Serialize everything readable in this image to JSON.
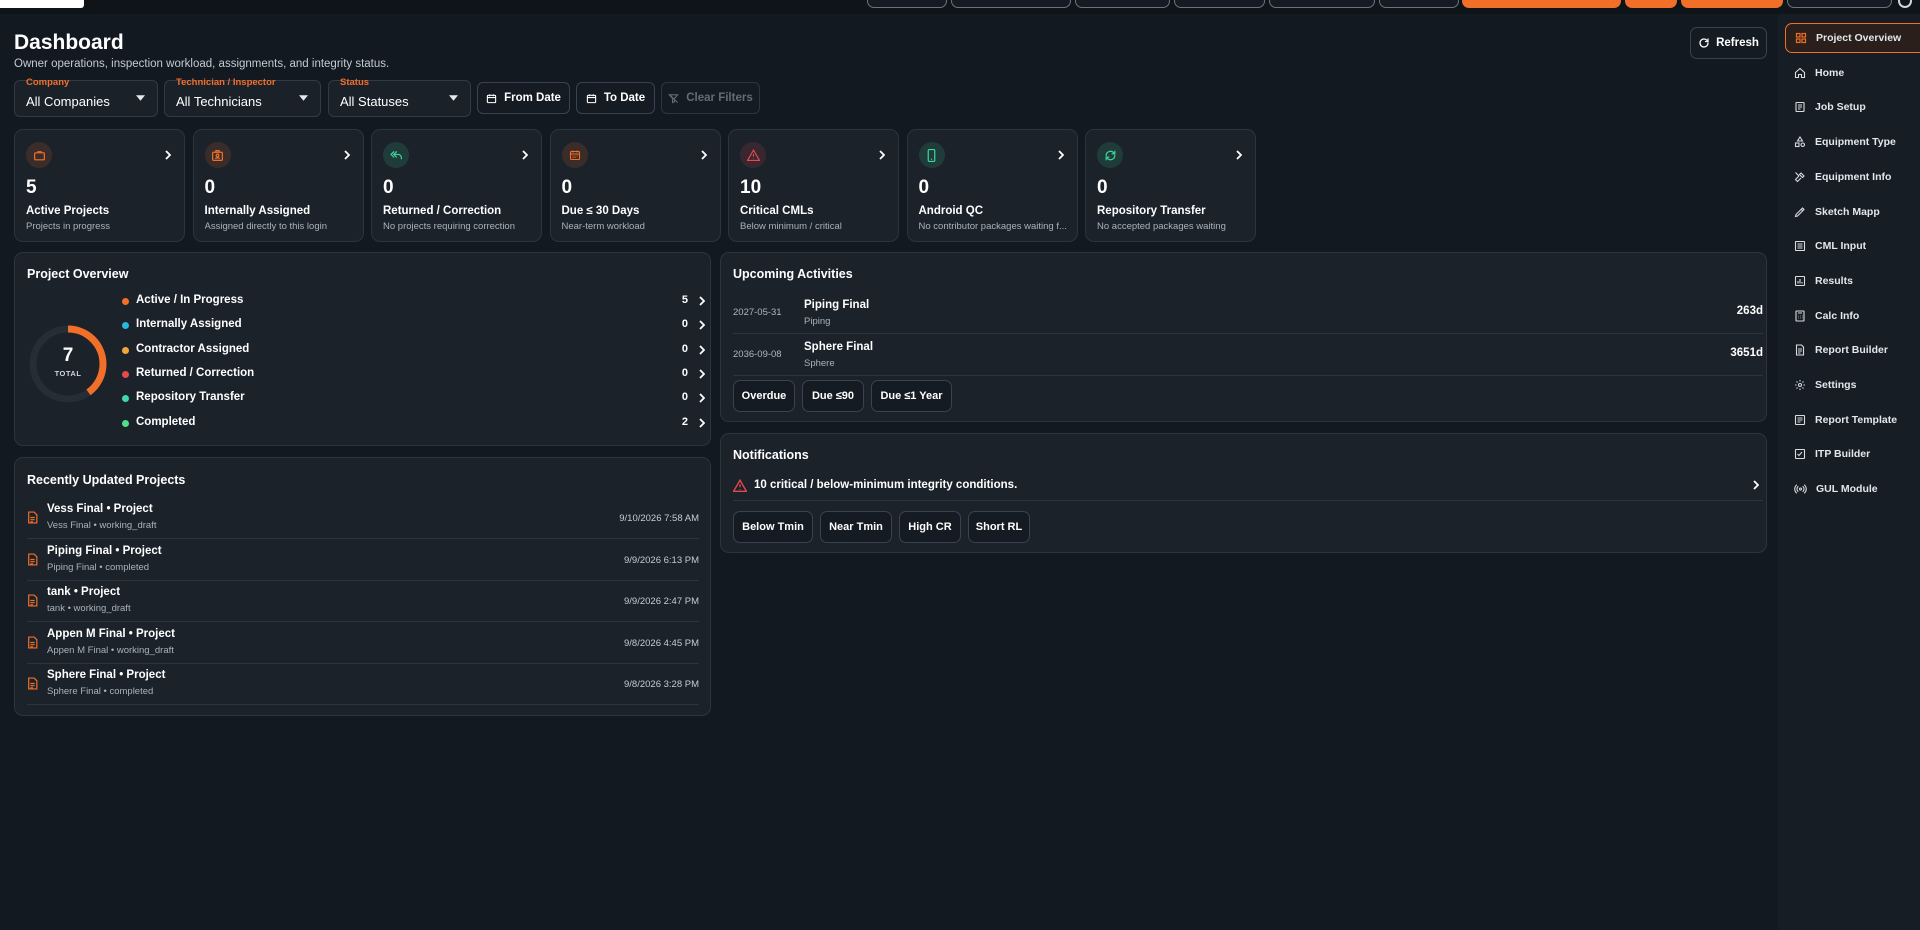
{
  "page": {
    "title": "Dashboard",
    "subtitle": "Owner operations, inspection workload, assignments, and integrity status.",
    "refresh_label": "Refresh"
  },
  "filters": {
    "company": {
      "label": "Company",
      "value": "All Companies"
    },
    "technician": {
      "label": "Technician / Inspector",
      "value": "All Technicians"
    },
    "status": {
      "label": "Status",
      "value": "All Statuses"
    },
    "from_date": "From Date",
    "to_date": "To Date",
    "clear": "Clear Filters"
  },
  "stats": [
    {
      "value": "5",
      "label": "Active Projects",
      "sub": "Projects in progress",
      "icon": "briefcase-icon",
      "color": "#f26f2a"
    },
    {
      "value": "0",
      "label": "Internally Assigned",
      "sub": "Assigned directly to this login",
      "icon": "user-badge-icon",
      "color": "#f26f2a"
    },
    {
      "value": "0",
      "label": "Returned / Correction",
      "sub": "No projects requiring correction",
      "icon": "reply-all-icon",
      "color": "#3fd69b"
    },
    {
      "value": "0",
      "label": "Due ≤ 30 Days",
      "sub": "Near-term workload",
      "icon": "calendar-icon",
      "color": "#f26f2a"
    },
    {
      "value": "10",
      "label": "Critical CMLs",
      "sub": "Below minimum / critical",
      "icon": "warning-icon",
      "color": "#e5484d"
    },
    {
      "value": "0",
      "label": "Android QC",
      "sub": "No contributor packages waiting f...",
      "icon": "mobile-icon",
      "color": "#3fd69b"
    },
    {
      "value": "0",
      "label": "Repository Transfer",
      "sub": "No accepted packages waiting",
      "icon": "sync-icon",
      "color": "#3fd69b"
    }
  ],
  "overview": {
    "title": "Project Overview",
    "total": "7",
    "total_label": "TOTAL",
    "items": [
      {
        "label": "Active / In Progress",
        "count": "5",
        "color": "#f26f2a"
      },
      {
        "label": "Internally Assigned",
        "count": "0",
        "color": "#2bb5e0"
      },
      {
        "label": "Contractor Assigned",
        "count": "0",
        "color": "#f2a53a"
      },
      {
        "label": "Returned / Correction",
        "count": "0",
        "color": "#e5484d"
      },
      {
        "label": "Repository Transfer",
        "count": "0",
        "color": "#3fd6b0"
      },
      {
        "label": "Completed",
        "count": "2",
        "color": "#4fe08a"
      }
    ]
  },
  "recent": {
    "title": "Recently Updated Projects",
    "items": [
      {
        "title": "Vess Final • Project",
        "sub": "Vess Final • working_draft",
        "time": "9/10/2026 7:58 AM"
      },
      {
        "title": "Piping Final • Project",
        "sub": "Piping Final • completed",
        "time": "9/9/2026 6:13 PM"
      },
      {
        "title": "tank • Project",
        "sub": "tank • working_draft",
        "time": "9/9/2026 2:47 PM"
      },
      {
        "title": "Appen M Final • Project",
        "sub": "Appen M Final • working_draft",
        "time": "9/8/2026 4:45 PM"
      },
      {
        "title": "Sphere Final • Project",
        "sub": "Sphere Final • completed",
        "time": "9/8/2026 3:28 PM"
      }
    ]
  },
  "upcoming": {
    "title": "Upcoming Activities",
    "items": [
      {
        "date": "2027-05-31",
        "title": "Piping Final",
        "sub": "Piping",
        "days": "263d"
      },
      {
        "date": "2036-09-08",
        "title": "Sphere Final",
        "sub": "Sphere",
        "days": "3651d"
      }
    ],
    "chips": [
      "Overdue",
      "Due ≤90",
      "Due ≤1 Year"
    ]
  },
  "notifications": {
    "title": "Notifications",
    "message": "10 critical / below-minimum integrity conditions.",
    "chips": [
      "Below Tmin",
      "Near Tmin",
      "High CR",
      "Short RL"
    ]
  },
  "sidebar": {
    "items": [
      {
        "label": "Project Overview",
        "icon": "grid-icon",
        "active": true
      },
      {
        "label": "Home",
        "icon": "home-icon"
      },
      {
        "label": "Job Setup",
        "icon": "clipboard-icon"
      },
      {
        "label": "Equipment Type",
        "icon": "shapes-icon"
      },
      {
        "label": "Equipment Info",
        "icon": "tool-icon"
      },
      {
        "label": "Sketch Mapp",
        "icon": "pencil-icon"
      },
      {
        "label": "CML Input",
        "icon": "list-icon"
      },
      {
        "label": "Results",
        "icon": "chart-icon"
      },
      {
        "label": "Calc Info",
        "icon": "calculator-icon"
      },
      {
        "label": "Report Builder",
        "icon": "document-icon"
      },
      {
        "label": "Settings",
        "icon": "gear-icon"
      },
      {
        "label": "Report Template",
        "icon": "template-icon"
      },
      {
        "label": "ITP Builder",
        "icon": "checklist-icon"
      },
      {
        "label": "GUL Module",
        "icon": "radio-icon"
      }
    ]
  },
  "colors": {
    "accent": "#f26f2a",
    "background": "#131920",
    "card": "#1b222a",
    "success": "#3fd69b",
    "danger": "#e5484d"
  }
}
